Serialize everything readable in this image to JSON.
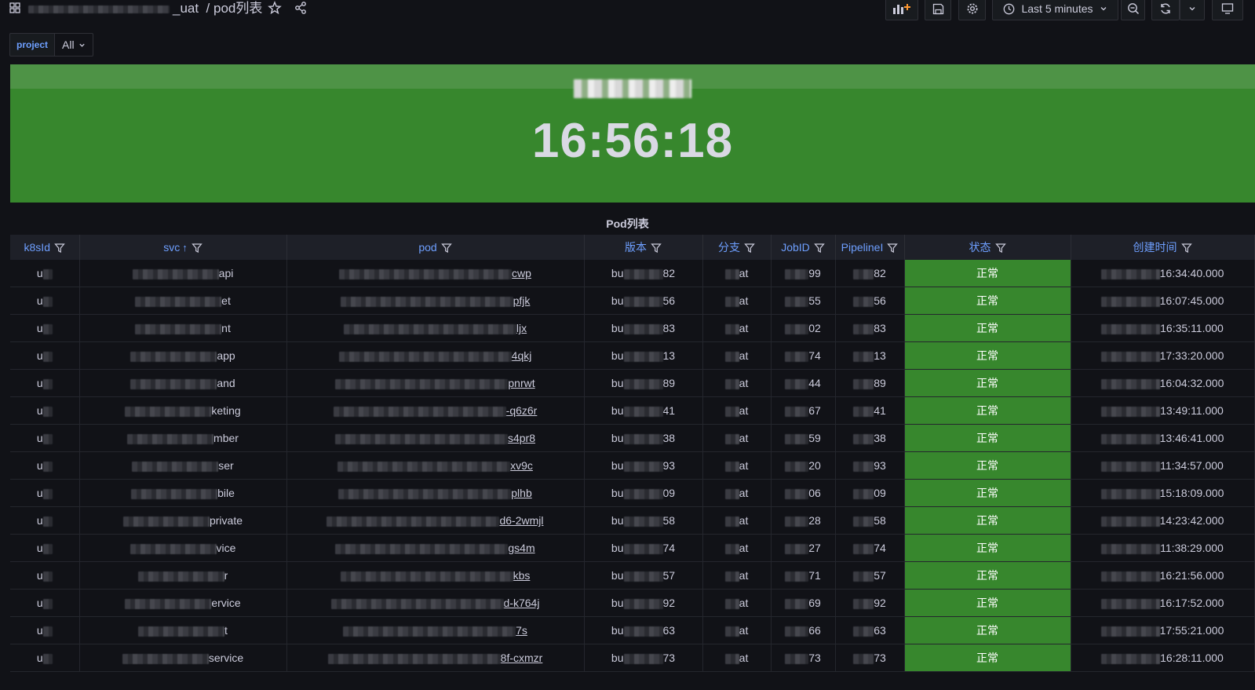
{
  "header": {
    "title_suffix": "_uat",
    "title_page": "/ pod列表",
    "time_range": "Last 5 minutes"
  },
  "variables": {
    "label": "project",
    "value": "All"
  },
  "clock": {
    "time": "16:56:18"
  },
  "panel": {
    "title": "Pod列表"
  },
  "table": {
    "columns": [
      "k8sId",
      "svc",
      "pod",
      "版本",
      "分支",
      "JobID",
      "PipelineI",
      "状态",
      "创建时间"
    ],
    "rows": [
      {
        "k8s": "u",
        "svc": "api",
        "pod": "cwp",
        "ver_pre": "bu",
        "ver": "82",
        "branch": "at",
        "job": "99",
        "pipe": "82",
        "status": "正常",
        "time": "16:34:40.000"
      },
      {
        "k8s": "u",
        "svc": "et",
        "pod": "pfjk",
        "ver_pre": "bu",
        "ver": "56",
        "branch": "at",
        "job": "55",
        "pipe": "56",
        "status": "正常",
        "time": "16:07:45.000"
      },
      {
        "k8s": "u",
        "svc": "nt",
        "pod": "ljx",
        "ver_pre": "bu",
        "ver": "83",
        "branch": "at",
        "job": "02",
        "pipe": "83",
        "status": "正常",
        "time": "16:35:11.000"
      },
      {
        "k8s": "u",
        "svc": "app",
        "pod": "4qkj",
        "ver_pre": "bu",
        "ver": "13",
        "branch": "at",
        "job": "74",
        "pipe": "13",
        "status": "正常",
        "time": "17:33:20.000"
      },
      {
        "k8s": "u",
        "svc": "and",
        "pod": "pnrwt",
        "ver_pre": "bu",
        "ver": "89",
        "branch": "at",
        "job": "44",
        "pipe": "89",
        "status": "正常",
        "time": "16:04:32.000"
      },
      {
        "k8s": "u",
        "svc": "keting",
        "pod": "-q6z6r",
        "ver_pre": "bu",
        "ver": "41",
        "branch": "at",
        "job": "67",
        "pipe": "41",
        "status": "正常",
        "time": "13:49:11.000"
      },
      {
        "k8s": "u",
        "svc": "mber",
        "pod": "s4pr8",
        "ver_pre": "bu",
        "ver": "38",
        "branch": "at",
        "job": "59",
        "pipe": "38",
        "status": "正常",
        "time": "13:46:41.000"
      },
      {
        "k8s": "u",
        "svc": "ser",
        "pod": "xv9c",
        "ver_pre": "bu",
        "ver": "93",
        "branch": "at",
        "job": "20",
        "pipe": "93",
        "status": "正常",
        "time": "11:34:57.000"
      },
      {
        "k8s": "u",
        "svc": "bile",
        "pod": "plhb",
        "ver_pre": "bu",
        "ver": "09",
        "branch": "at",
        "job": "06",
        "pipe": "09",
        "status": "正常",
        "time": "15:18:09.000"
      },
      {
        "k8s": "u",
        "svc": "private",
        "pod": "d6-2wmjl",
        "ver_pre": "bu",
        "ver": "58",
        "branch": "at",
        "job": "28",
        "pipe": "58",
        "status": "正常",
        "time": "14:23:42.000"
      },
      {
        "k8s": "u",
        "svc": "vice",
        "pod": "gs4m",
        "ver_pre": "bu",
        "ver": "74",
        "branch": "at",
        "job": "27",
        "pipe": "74",
        "status": "正常",
        "time": "11:38:29.000"
      },
      {
        "k8s": "u",
        "svc": "r",
        "pod": "kbs",
        "ver_pre": "bu",
        "ver": "57",
        "branch": "at",
        "job": "71",
        "pipe": "57",
        "status": "正常",
        "time": "16:21:56.000"
      },
      {
        "k8s": "u",
        "svc": "ervice",
        "pod": "d-k764j",
        "ver_pre": "bu",
        "ver": "92",
        "branch": "at",
        "job": "69",
        "pipe": "92",
        "status": "正常",
        "time": "16:17:52.000"
      },
      {
        "k8s": "u",
        "svc": "t",
        "pod": "7s",
        "ver_pre": "bu",
        "ver": "63",
        "branch": "at",
        "job": "66",
        "pipe": "63",
        "status": "正常",
        "time": "17:55:21.000"
      },
      {
        "k8s": "u",
        "svc": "service",
        "pod": "8f-cxmzr",
        "ver_pre": "bu",
        "ver": "73",
        "branch": "at",
        "job": "73",
        "pipe": "73",
        "status": "正常",
        "time": "16:28:11.000"
      }
    ]
  },
  "colors": {
    "status_ok": "#37872d",
    "accent": "#6e9fff",
    "background": "#111217"
  }
}
